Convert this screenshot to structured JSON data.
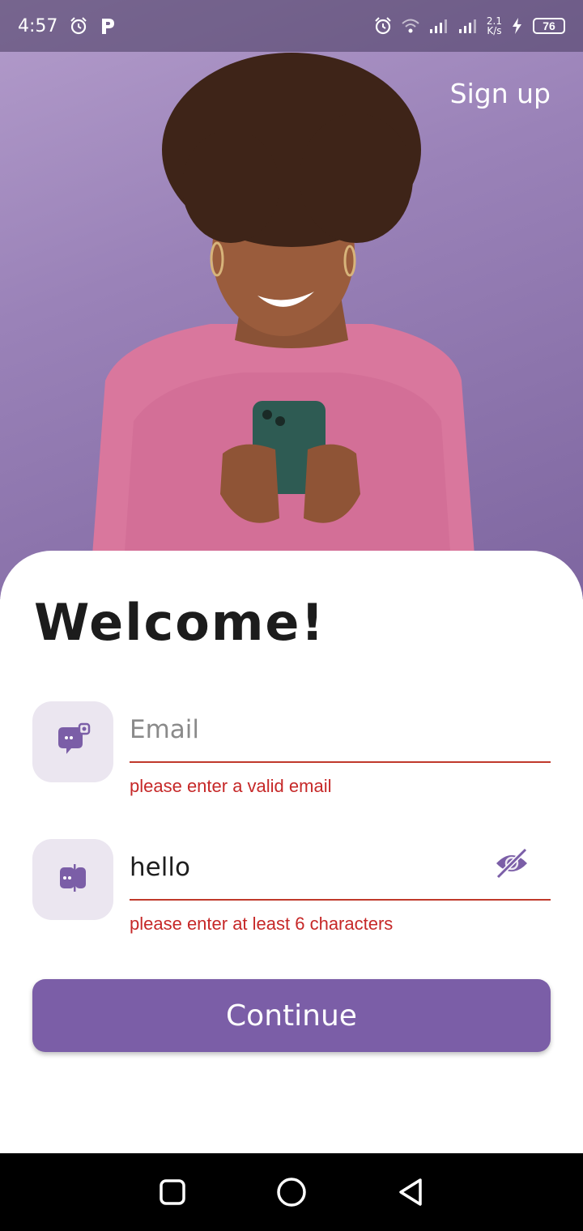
{
  "status_bar": {
    "time": "4:57",
    "net_speed_value": "2.1",
    "net_speed_unit": "K/s",
    "battery": "76"
  },
  "header": {
    "signup_label": "Sign up"
  },
  "login": {
    "title": "Welcome!",
    "email": {
      "placeholder": "Email",
      "value": "",
      "error": "please enter a valid email"
    },
    "password": {
      "value": "hello",
      "error": "please enter at least 6 characters"
    },
    "continue_label": "Continue"
  },
  "colors": {
    "accent": "#7b5ea7",
    "error": "#c62828",
    "icon_tile": "#ebe6f0"
  }
}
